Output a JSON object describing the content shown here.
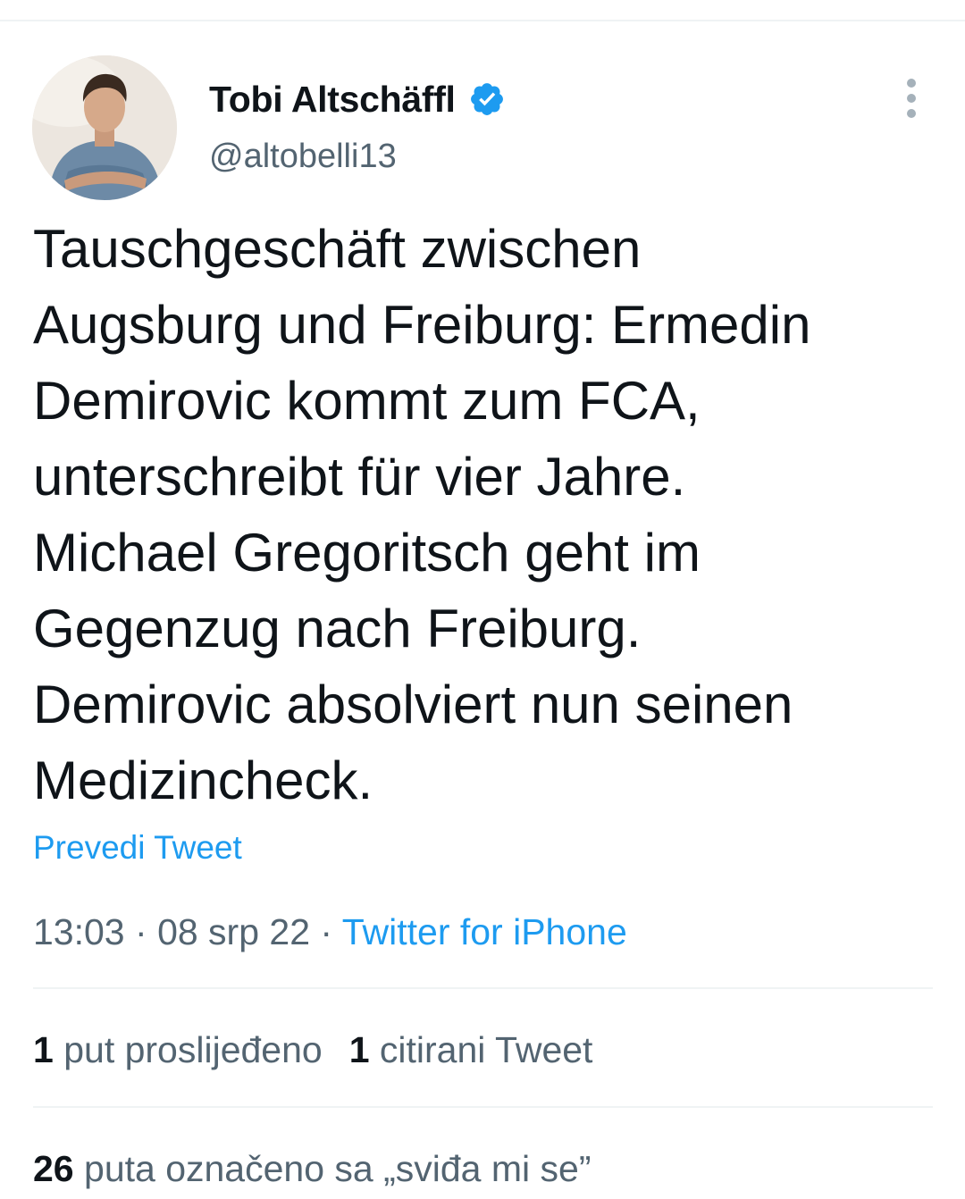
{
  "author": {
    "display_name": "Tobi Altschäffl",
    "handle": "@altobelli13",
    "verified_color": "#1d9bf0"
  },
  "tweet": {
    "lines": [
      "Tauschgeschäft zwischen",
      "Augsburg und Freiburg: Ermedin",
      "Demirovic kommt zum FCA,",
      "unterschreibt für vier Jahre.",
      "Michael Gregoritsch geht im",
      "Gegenzug nach Freiburg.",
      "Demirovic absolviert nun seinen",
      "Medizincheck."
    ],
    "translate_label": "Prevedi Tweet",
    "time": "13:03",
    "date": "08 srp 22",
    "source": "Twitter for iPhone"
  },
  "stats": {
    "retweets_count": "1",
    "retweets_label": "put proslijeđeno",
    "quotes_count": "1",
    "quotes_label": "citirani Tweet",
    "likes_count": "26",
    "likes_label": "puta označeno sa „sviđa mi se”"
  },
  "icons": {
    "more": "more-vertical-icon",
    "verified": "verified-badge-icon"
  },
  "colors": {
    "text": "#0f1419",
    "secondary": "#536471",
    "accent": "#1d9bf0",
    "divider": "#eff3f4"
  }
}
